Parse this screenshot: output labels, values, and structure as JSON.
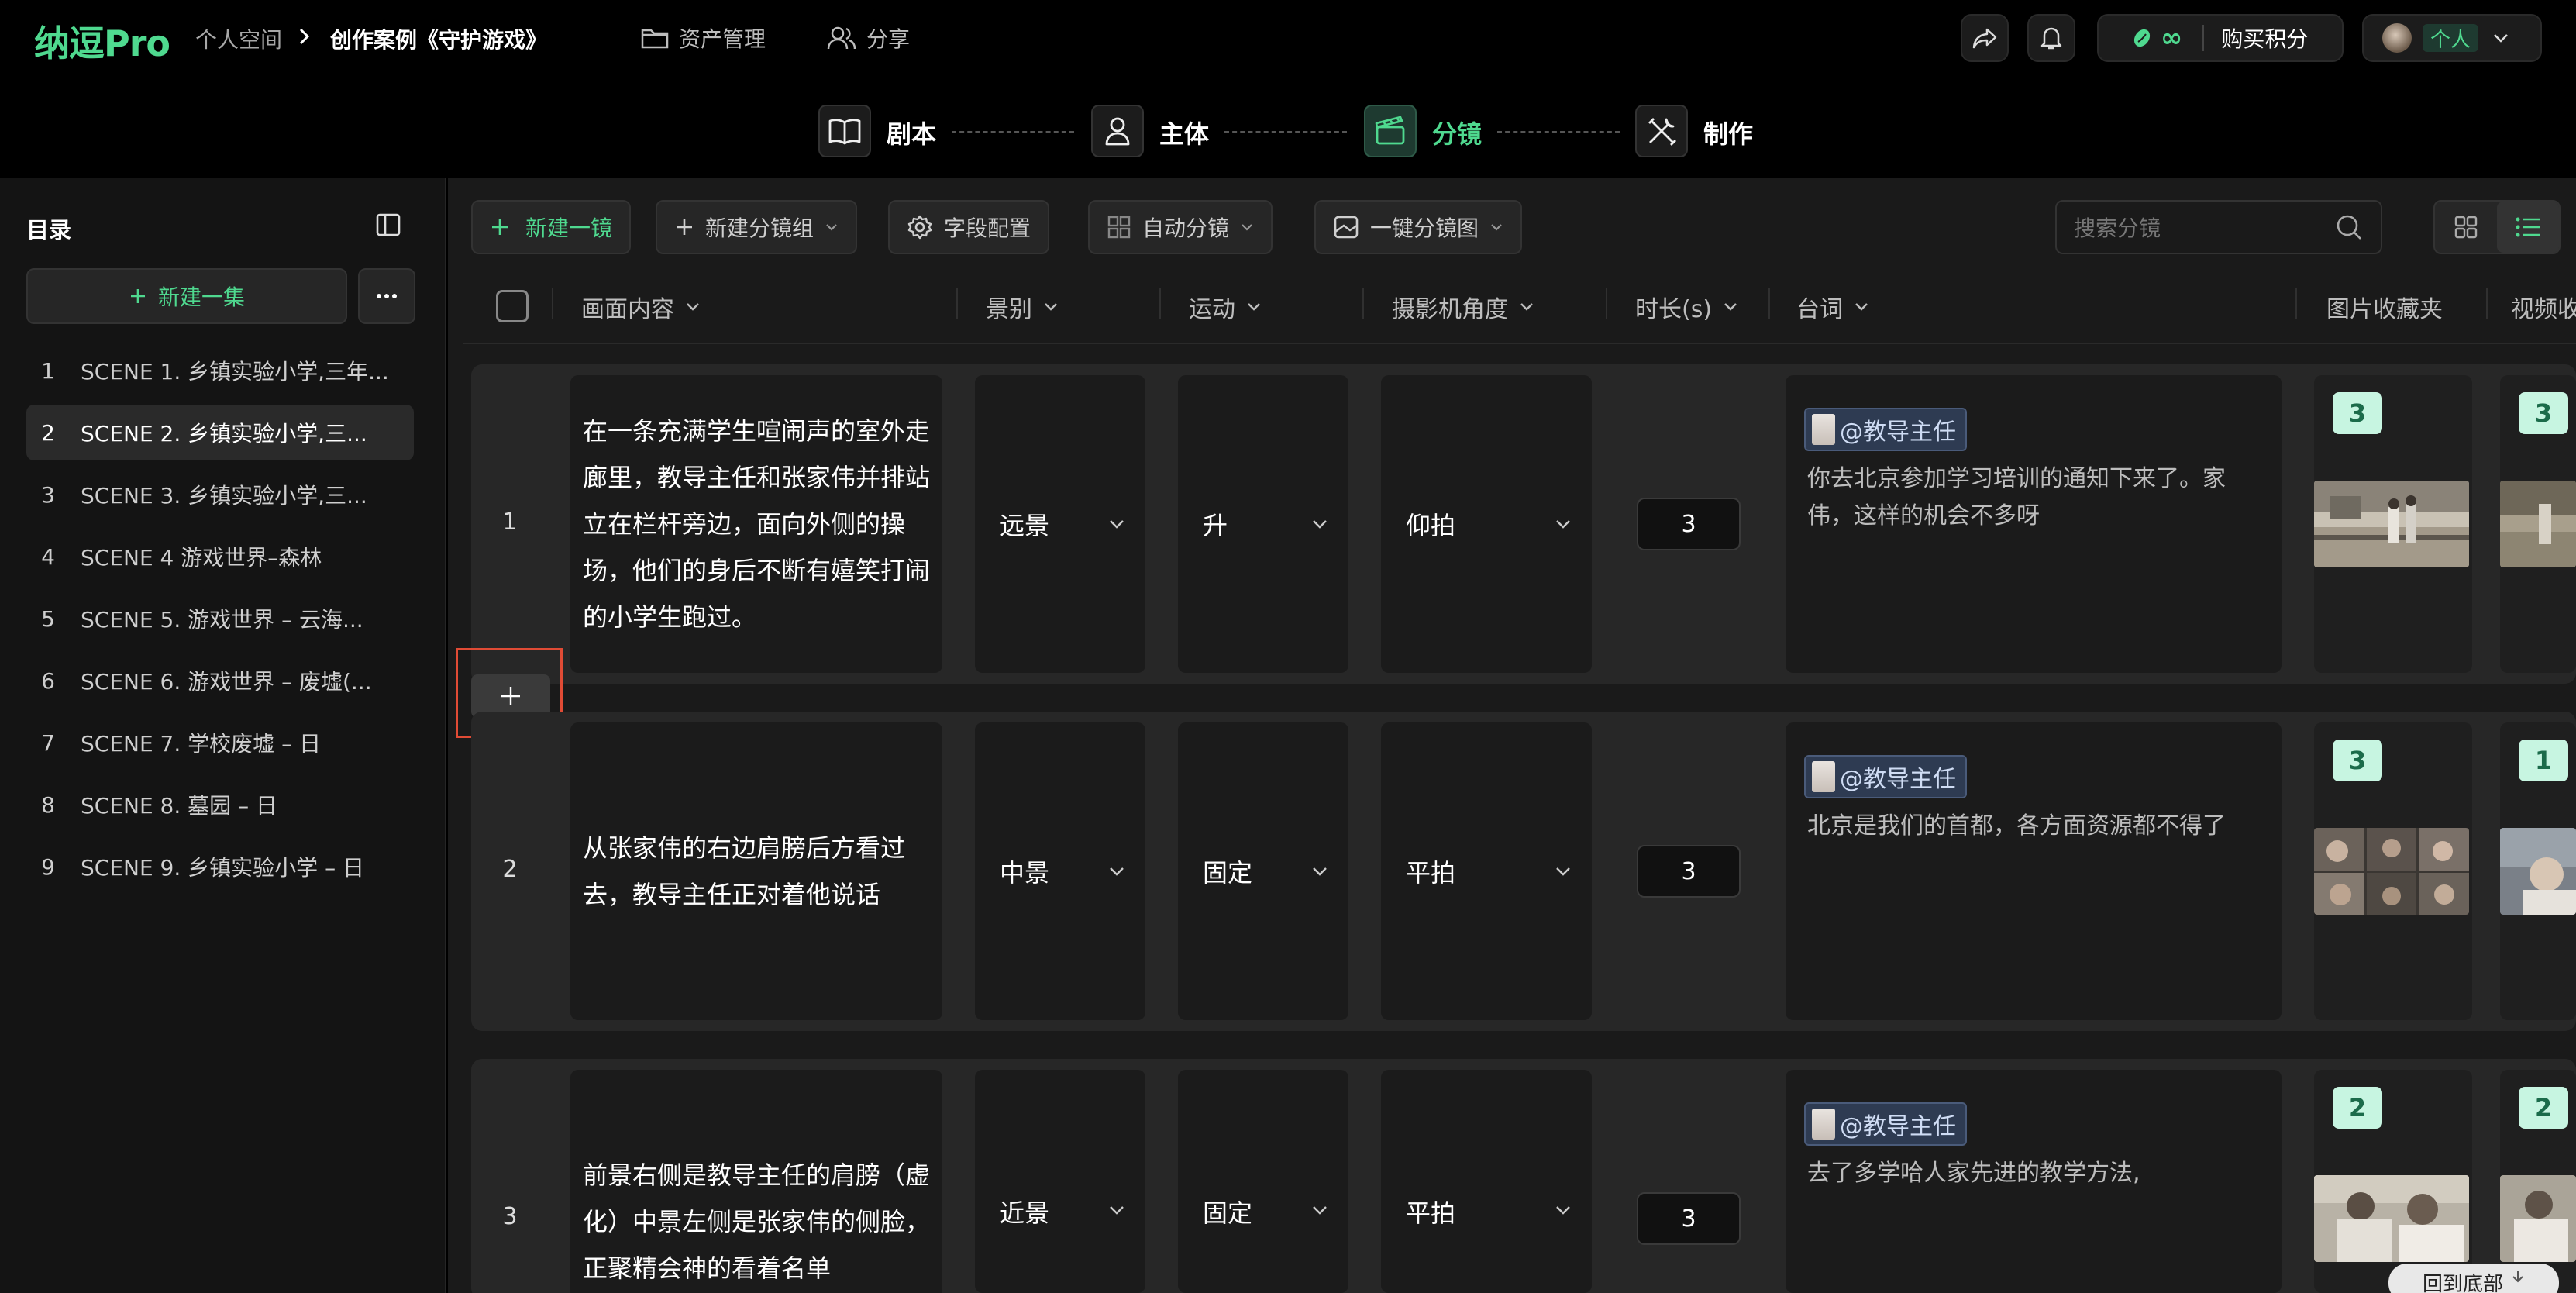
{
  "app": {
    "logo": "纳逗Pro"
  },
  "breadcrumb": {
    "home": "个人空间",
    "project": "创作案例《守护游戏》"
  },
  "topnav": {
    "assets": "资产管理",
    "share": "分享"
  },
  "topright": {
    "credits_symbol": "∞",
    "buy_credits": "购买积分",
    "account": "个人"
  },
  "steps": [
    {
      "label": "剧本",
      "icon": "book-icon"
    },
    {
      "label": "主体",
      "icon": "person-icon"
    },
    {
      "label": "分镜",
      "icon": "clapper-icon",
      "active": true
    },
    {
      "label": "制作",
      "icon": "tools-icon"
    }
  ],
  "sidebar": {
    "title": "目录",
    "new_episode": "新建一集",
    "scenes": [
      {
        "num": "1",
        "label": "SCENE 1. 乡镇实验小学,三年..."
      },
      {
        "num": "2",
        "label": "SCENE 2. 乡镇实验小学,三...",
        "selected": true
      },
      {
        "num": "3",
        "label": "SCENE 3. 乡镇实验小学,三..."
      },
      {
        "num": "4",
        "label": "SCENE 4 游戏世界–森林"
      },
      {
        "num": "5",
        "label": "SCENE 5. 游戏世界 – 云海..."
      },
      {
        "num": "6",
        "label": "SCENE 6. 游戏世界 – 废墟(..."
      },
      {
        "num": "7",
        "label": "SCENE 7. 学校废墟 – 日"
      },
      {
        "num": "8",
        "label": "SCENE 8. 墓园 – 日"
      },
      {
        "num": "9",
        "label": "SCENE 9. 乡镇实验小学 – 日"
      }
    ]
  },
  "toolbar": {
    "new_shot": "新建一镜",
    "new_group": "新建分镜组",
    "field_config": "字段配置",
    "auto_shot": "自动分镜",
    "one_click": "一键分镜图",
    "search_placeholder": "搜索分镜"
  },
  "columns": {
    "content": "画面内容",
    "shot_size": "景别",
    "movement": "运动",
    "angle": "摄影机角度",
    "duration": "时长(s)",
    "dialogue": "台词",
    "image_folder": "图片收藏夹",
    "video_folder": "视频收"
  },
  "rows": [
    {
      "num": "1",
      "content": "在一条充满学生喧闹声的室外走廊里，教导主任和张家伟并排站立在栏杆旁边，面向外侧的操场，他们的身后不断有嬉笑打闹的小学生跑过。",
      "shot_size": "远景",
      "movement": "升",
      "angle": "仰拍",
      "duration": "3",
      "speaker": "@教导主任",
      "dialogue": "你去北京参加学习培训的通知下来了。家伟，这样的机会不多呀",
      "img_count": "3",
      "video_count": "3"
    },
    {
      "num": "2",
      "content": "从张家伟的右边肩膀后方看过去，教导主任正对着他说话",
      "shot_size": "中景",
      "movement": "固定",
      "angle": "平拍",
      "duration": "3",
      "speaker": "@教导主任",
      "dialogue": "北京是我们的首都，各方面资源都不得了",
      "img_count": "3",
      "video_count": "1"
    },
    {
      "num": "3",
      "content": "前景右侧是教导主任的肩膀（虚化）中景左侧是张家伟的侧脸，正聚精会神的看着名单",
      "shot_size": "近景",
      "movement": "固定",
      "angle": "平拍",
      "duration": "3",
      "speaker": "@教导主任",
      "dialogue": "去了多学哈人家先进的教学方法,",
      "img_count": "2",
      "video_count": "2"
    }
  ],
  "back_to_bottom": "回到底部",
  "colors": {
    "accent": "#4fd98f",
    "badge_bg": "#c7f5e1",
    "highlight": "#e04b35"
  }
}
